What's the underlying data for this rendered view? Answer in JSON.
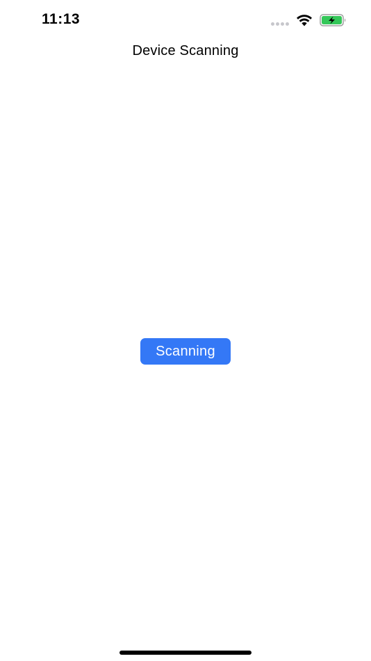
{
  "status_bar": {
    "time": "11:13",
    "signal_icon": "cellular-dots-icon",
    "wifi_icon": "wifi-icon",
    "battery_icon": "battery-charging-icon",
    "battery_color": "#34c759"
  },
  "nav": {
    "title": "Device Scanning"
  },
  "main": {
    "scan_button_label": "Scanning",
    "accent_color": "#3478f6"
  }
}
